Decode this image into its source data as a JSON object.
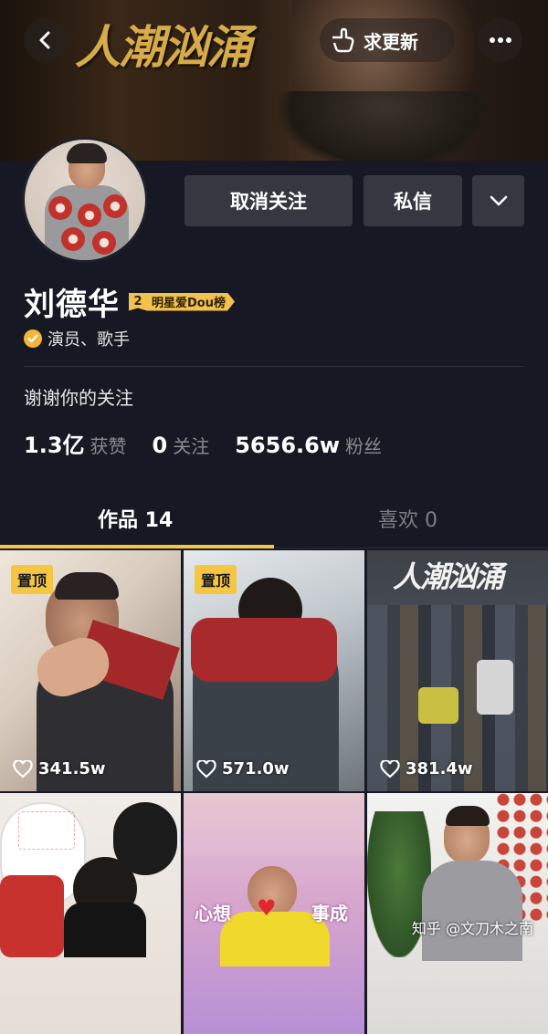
{
  "header": {
    "banner_title": "人潮汹涌",
    "request_update_label": "求更新"
  },
  "profile": {
    "name": "刘德华",
    "rank_number": "2",
    "rank_label": "明星爱Dou榜",
    "verified_text": "演员、歌手",
    "bio": "谢谢你的关注"
  },
  "actions": {
    "unfollow_label": "取消关注",
    "message_label": "私信"
  },
  "stats": [
    {
      "value": "1.3亿",
      "label": "获赞"
    },
    {
      "value": "0",
      "label": "关注"
    },
    {
      "value": "5656.6w",
      "label": "粉丝"
    }
  ],
  "tabs": {
    "works_label": "作品 14",
    "likes_label": "喜欢 0"
  },
  "grid": {
    "pin_label": "置顶",
    "tiles": [
      {
        "likes": "341.5w",
        "pinned": true
      },
      {
        "likes": "571.0w",
        "pinned": true
      },
      {
        "likes": "381.4w",
        "pinned": false,
        "overlay_title": "人潮汹涌"
      },
      {
        "likes": "",
        "pinned": false
      },
      {
        "likes": "",
        "pinned": false,
        "overlay_text_left": "心想",
        "overlay_text_right": "事成"
      },
      {
        "likes": "",
        "pinned": false
      }
    ]
  },
  "watermark": "知乎 @文刀木之南",
  "colors": {
    "background": "#161823",
    "button_bg": "#363841",
    "accent_yellow": "#f4c642",
    "muted_text": "#8a8b91"
  }
}
